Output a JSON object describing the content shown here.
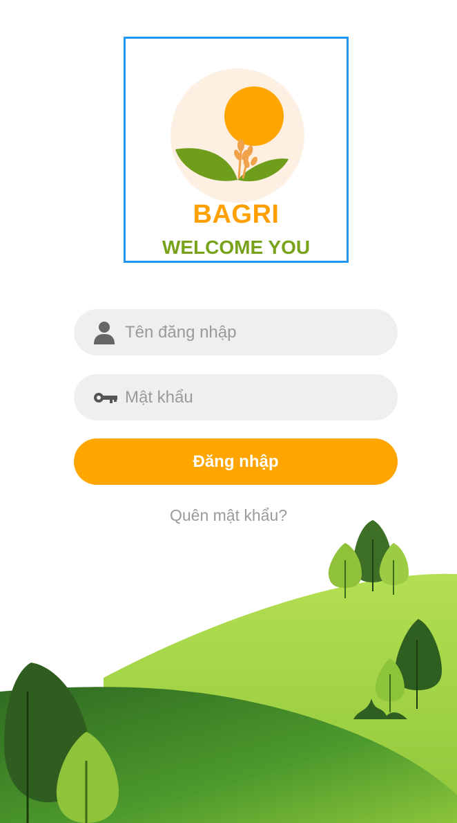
{
  "logo": {
    "brand": "BAGRI",
    "tagline": "WELCOME YOU"
  },
  "form": {
    "username_placeholder": "Tên đăng nhập",
    "username_value": "",
    "password_placeholder": "Mật khẩu",
    "password_value": "",
    "login_label": "Đăng nhập",
    "forgot_label": "Quên mật khẩu?"
  },
  "colors": {
    "accent": "#ffa500",
    "brand_orange": "#ffa000",
    "brand_green": "#77a21a",
    "logo_border": "#2196f3"
  },
  "icons": {
    "username": "user-icon",
    "password": "key-icon"
  }
}
